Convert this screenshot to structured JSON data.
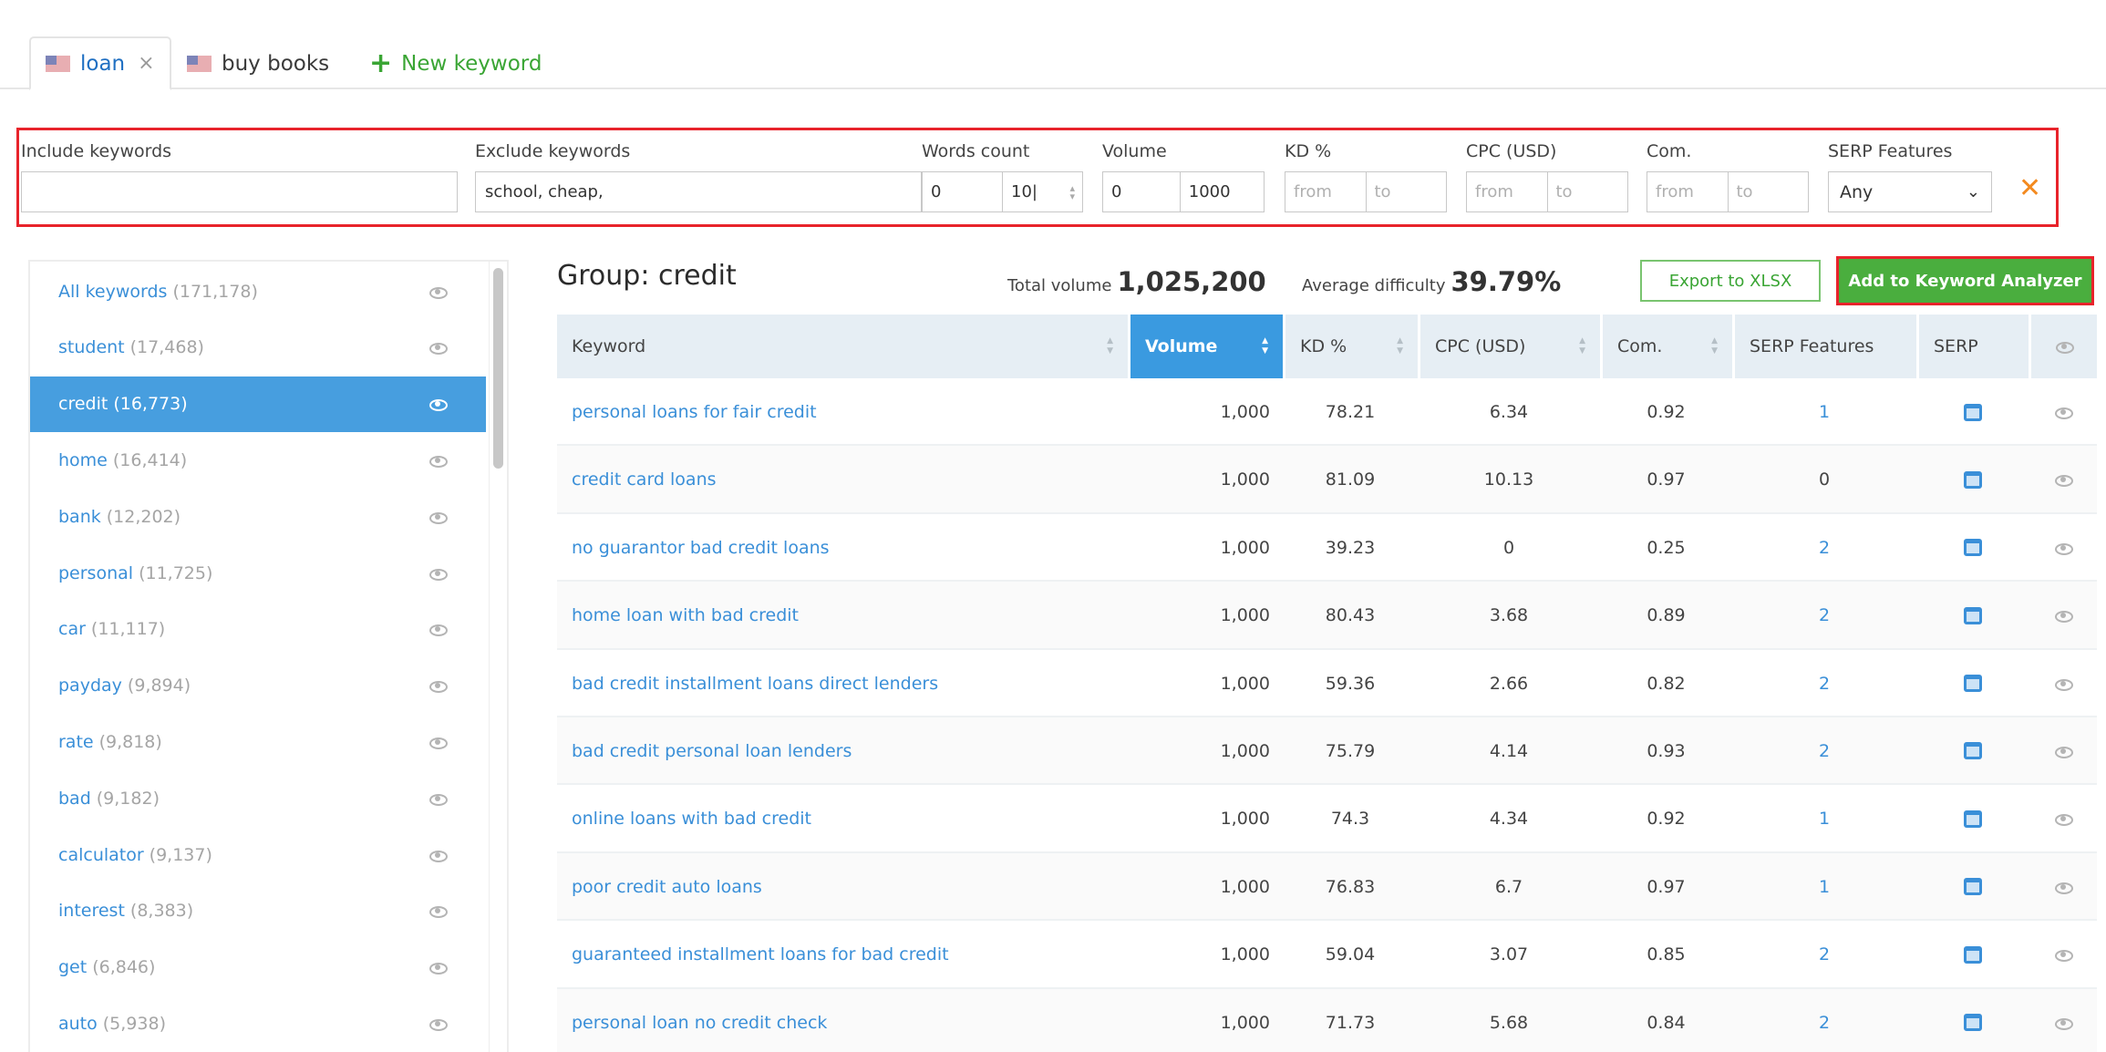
{
  "tabs": [
    {
      "label": "loan",
      "flag": "us-flag-icon",
      "active": true,
      "closable": true
    },
    {
      "label": "buy books",
      "flag": "us-flag-icon",
      "active": false,
      "closable": false
    }
  ],
  "new_keyword": {
    "icon": "+",
    "label": "New keyword"
  },
  "filters": {
    "include": {
      "label": "Include keywords",
      "value": ""
    },
    "exclude": {
      "label": "Exclude keywords",
      "value": "school, cheap,"
    },
    "words_count": {
      "label": "Words count",
      "from": "0",
      "to": "10|"
    },
    "volume": {
      "label": "Volume",
      "from": "0",
      "to": "1000"
    },
    "kd": {
      "label": "KD %",
      "from_placeholder": "from",
      "to_placeholder": "to"
    },
    "cpc": {
      "label": "CPC (USD)",
      "from_placeholder": "from",
      "to_placeholder": "to"
    },
    "com": {
      "label": "Com.",
      "from_placeholder": "from",
      "to_placeholder": "to"
    },
    "serp_features": {
      "label": "SERP Features",
      "selected": "Any",
      "chevron": "⌄"
    },
    "clear_icon": "✕"
  },
  "sidebar": {
    "items": [
      {
        "name": "All keywords",
        "count": "(171,178)"
      },
      {
        "name": "student",
        "count": "(17,468)"
      },
      {
        "name": "credit",
        "count": "(16,773)",
        "selected": true
      },
      {
        "name": "home",
        "count": "(16,414)"
      },
      {
        "name": "bank",
        "count": "(12,202)"
      },
      {
        "name": "personal",
        "count": "(11,725)"
      },
      {
        "name": "car",
        "count": "(11,117)"
      },
      {
        "name": "payday",
        "count": "(9,894)"
      },
      {
        "name": "rate",
        "count": "(9,818)"
      },
      {
        "name": "bad",
        "count": "(9,182)"
      },
      {
        "name": "calculator",
        "count": "(9,137)"
      },
      {
        "name": "interest",
        "count": "(8,383)"
      },
      {
        "name": "get",
        "count": "(6,846)"
      },
      {
        "name": "auto",
        "count": "(5,938)"
      }
    ]
  },
  "group": {
    "title": "Group:  credit",
    "total_volume_label": "Total volume",
    "total_volume": "1,025,200",
    "avg_difficulty_label": "Average difficulty",
    "avg_difficulty": "39.79%"
  },
  "buttons": {
    "export": "Export to XLSX",
    "add": "Add to Keyword Analyzer"
  },
  "table": {
    "headers": {
      "keyword": "Keyword",
      "volume": "Volume",
      "kd": "KD %",
      "cpc": "CPC (USD)",
      "com": "Com.",
      "serp_features": "SERP Features",
      "serp": "SERP"
    },
    "sorted_by": "volume",
    "rows": [
      {
        "keyword": "personal loans for fair credit",
        "volume": "1,000",
        "kd": "78.21",
        "cpc": "6.34",
        "com": "0.92",
        "serp_features": "1"
      },
      {
        "keyword": "credit card loans",
        "volume": "1,000",
        "kd": "81.09",
        "cpc": "10.13",
        "com": "0.97",
        "serp_features": "0"
      },
      {
        "keyword": "no guarantor bad credit loans",
        "volume": "1,000",
        "kd": "39.23",
        "cpc": "0",
        "com": "0.25",
        "serp_features": "2"
      },
      {
        "keyword": "home loan with bad credit",
        "volume": "1,000",
        "kd": "80.43",
        "cpc": "3.68",
        "com": "0.89",
        "serp_features": "2"
      },
      {
        "keyword": "bad credit installment loans direct lenders",
        "volume": "1,000",
        "kd": "59.36",
        "cpc": "2.66",
        "com": "0.82",
        "serp_features": "2"
      },
      {
        "keyword": "bad credit personal loan lenders",
        "volume": "1,000",
        "kd": "75.79",
        "cpc": "4.14",
        "com": "0.93",
        "serp_features": "2"
      },
      {
        "keyword": "online loans with bad credit",
        "volume": "1,000",
        "kd": "74.3",
        "cpc": "4.34",
        "com": "0.92",
        "serp_features": "1"
      },
      {
        "keyword": "poor credit auto loans",
        "volume": "1,000",
        "kd": "76.83",
        "cpc": "6.7",
        "com": "0.97",
        "serp_features": "1"
      },
      {
        "keyword": "guaranteed installment loans for bad credit",
        "volume": "1,000",
        "kd": "59.04",
        "cpc": "3.07",
        "com": "0.85",
        "serp_features": "2"
      },
      {
        "keyword": "personal loan no credit check",
        "volume": "1,000",
        "kd": "71.73",
        "cpc": "5.68",
        "com": "0.84",
        "serp_features": "2"
      }
    ]
  },
  "colors": {
    "accent_blue": "#3a9ae0",
    "link_blue": "#3a8fd8",
    "selected_blue": "#479edf",
    "green": "#4aae3e",
    "highlight_red": "#e8232b",
    "clear_orange": "#f38a1f"
  }
}
